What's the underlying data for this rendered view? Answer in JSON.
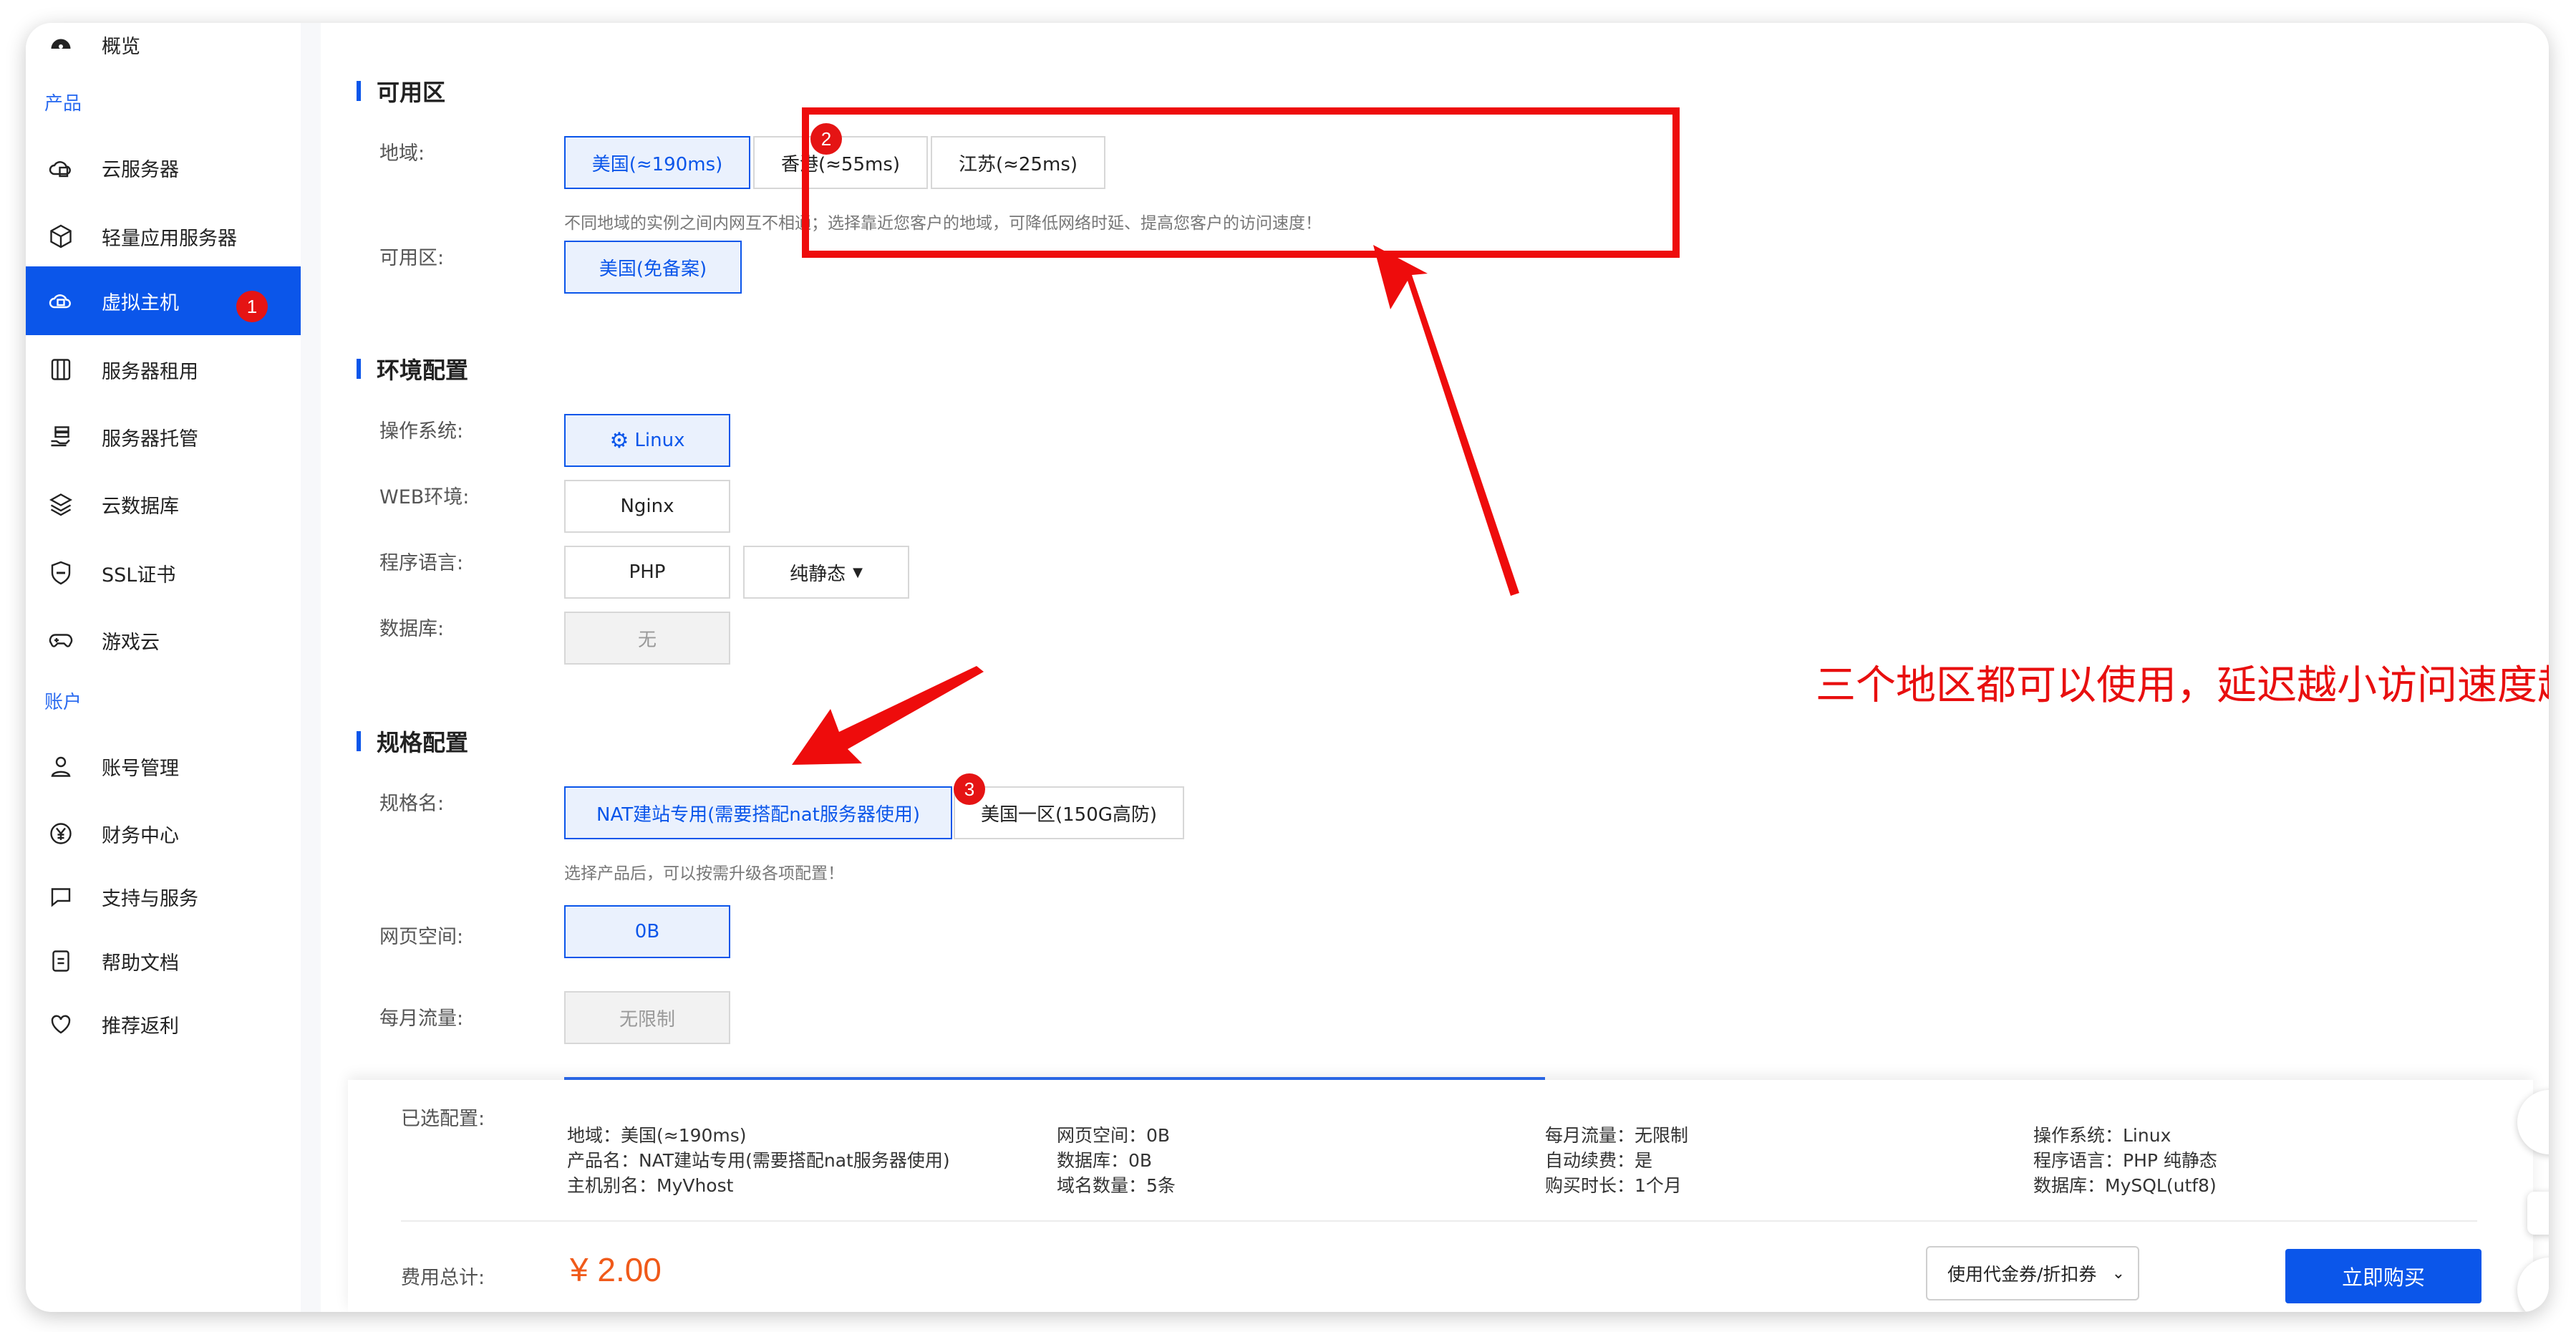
{
  "sidebar": {
    "overview": "概览",
    "section_products": "产品",
    "items": [
      {
        "label": "云服务器"
      },
      {
        "label": "轻量应用服务器"
      },
      {
        "label": "虚拟主机"
      },
      {
        "label": "服务器租用"
      },
      {
        "label": "服务器托管"
      },
      {
        "label": "云数据库"
      },
      {
        "label": "SSL证书"
      },
      {
        "label": "游戏云"
      }
    ],
    "section_account": "账户",
    "account_items": [
      {
        "label": "账号管理"
      },
      {
        "label": "财务中心"
      },
      {
        "label": "支持与服务"
      },
      {
        "label": "帮助文档"
      },
      {
        "label": "推荐返利"
      }
    ]
  },
  "badges": {
    "one": "1",
    "two": "2",
    "three": "3"
  },
  "availability": {
    "title": "可用区",
    "region_label": "地域:",
    "regions": [
      "美国(≈190ms)",
      "香港(≈55ms)",
      "江苏(≈25ms)"
    ],
    "region_hint": "不同地域的实例之间内网互不相通；选择靠近您客户的地域，可降低网络时延、提高您客户的访问速度！",
    "zone_label": "可用区:",
    "zone": "美国(免备案)"
  },
  "environment": {
    "title": "环境配置",
    "os_label": "操作系统:",
    "os": "Linux",
    "web_label": "WEB环境:",
    "web": "Nginx",
    "lang_label": "程序语言:",
    "lang": "PHP",
    "lang_option": "纯静态",
    "db_label": "数据库:",
    "db": "无"
  },
  "spec": {
    "title": "规格配置",
    "name_label": "规格名:",
    "names": [
      "NAT建站专用(需要搭配nat服务器使用)",
      "美国一区(150G高防)"
    ],
    "hint": "选择产品后，可以按需升级各项配置！",
    "space_label": "网页空间:",
    "space": "0B",
    "traffic_label": "每月流量:",
    "traffic": "无限制"
  },
  "annotation": "三个地区都可以使用，延迟越小访问速度越快",
  "summary": {
    "selected_label": "已选配置:",
    "col1": [
      "地域：美国(≈190ms)",
      "产品名：NAT建站专用(需要搭配nat服务器使用)",
      "主机别名：MyVhost"
    ],
    "col2": [
      "网页空间：0B",
      "数据库：0B",
      "域名数量：5条"
    ],
    "col3": [
      "每月流量：无限制",
      "自动续费：是",
      "购买时长：1个月"
    ],
    "col4": [
      "操作系统：Linux",
      "程序语言：PHP 纯静态",
      "数据库：MySQL(utf8)"
    ],
    "total_label": "费用总计:",
    "total": "¥ 2.00",
    "coupon": "使用代金券/折扣券",
    "buy": "立即购买"
  },
  "colors": {
    "accent": "#0b56ea",
    "annotation_red": "#ee0c0c",
    "price_orange": "#f05a1a"
  }
}
